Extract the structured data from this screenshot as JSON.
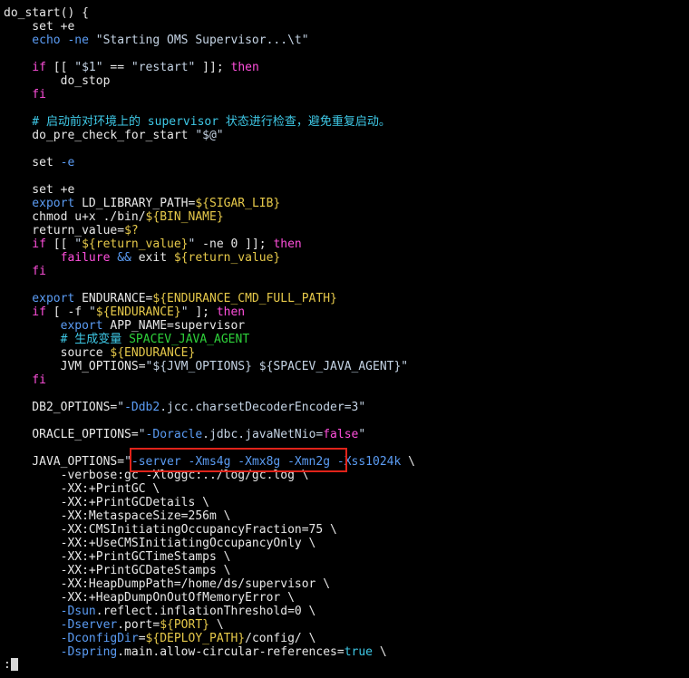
{
  "colors": {
    "default": "#e8e8e8",
    "keyword": "#ff4fdc",
    "string": "#c4d3e4",
    "variable": "#e6c94a",
    "option": "#5b9cf4",
    "comment": "#3ec8e6",
    "comment_text": "#2ed13a",
    "highlight_border": "#e0231a"
  },
  "lines": [
    [
      [
        "default",
        "do_start() {"
      ]
    ],
    [
      [
        "default",
        "    set +e"
      ]
    ],
    [
      [
        "option",
        "    echo -ne "
      ],
      [
        "string",
        "\"Starting OMS Supervisor...\\t\""
      ]
    ],
    [],
    [
      [
        "keyword",
        "    if"
      ],
      [
        "default",
        " [[ "
      ],
      [
        "string",
        "\"$1\""
      ],
      [
        "default",
        " == "
      ],
      [
        "string",
        "\"restart\""
      ],
      [
        "default",
        " ]]; "
      ],
      [
        "keyword",
        "then"
      ]
    ],
    [
      [
        "default",
        "        do_stop"
      ]
    ],
    [
      [
        "keyword",
        "    fi"
      ]
    ],
    [],
    [
      [
        "comment",
        "    # 启动前对环境上的 supervisor 状态进行检查，避免重复启动。"
      ]
    ],
    [
      [
        "default",
        "    do_pre_check_for_start "
      ],
      [
        "string",
        "\"$@\""
      ]
    ],
    [],
    [
      [
        "default",
        "    set "
      ],
      [
        "option",
        "-e"
      ]
    ],
    [],
    [
      [
        "default",
        "    set +e"
      ]
    ],
    [
      [
        "option",
        "    export"
      ],
      [
        "default",
        " LD_LIBRARY_PATH="
      ],
      [
        "variable",
        "${SIGAR_LIB}"
      ]
    ],
    [
      [
        "default",
        "    chmod u+x ./bin/"
      ],
      [
        "variable",
        "${BIN_NAME}"
      ]
    ],
    [
      [
        "default",
        "    return_value="
      ],
      [
        "variable",
        "$?"
      ]
    ],
    [
      [
        "keyword",
        "    if"
      ],
      [
        "default",
        " [[ "
      ],
      [
        "string",
        "\""
      ],
      [
        "variable",
        "${return_value}"
      ],
      [
        "string",
        "\""
      ],
      [
        "default",
        " -ne 0 ]]; "
      ],
      [
        "keyword",
        "then"
      ]
    ],
    [
      [
        "keyword",
        "        failure"
      ],
      [
        "default",
        " "
      ],
      [
        "option",
        "&&"
      ],
      [
        "default",
        " exit "
      ],
      [
        "variable",
        "${return_value}"
      ]
    ],
    [
      [
        "keyword",
        "    fi"
      ]
    ],
    [],
    [
      [
        "option",
        "    export"
      ],
      [
        "default",
        " ENDURANCE="
      ],
      [
        "variable",
        "${ENDURANCE_CMD_FULL_PATH}"
      ]
    ],
    [
      [
        "keyword",
        "    if"
      ],
      [
        "default",
        " [ -f "
      ],
      [
        "string",
        "\""
      ],
      [
        "variable",
        "${ENDURANCE}"
      ],
      [
        "string",
        "\""
      ],
      [
        "default",
        " ]; "
      ],
      [
        "keyword",
        "then"
      ]
    ],
    [
      [
        "option",
        "        export"
      ],
      [
        "default",
        " APP_NAME=supervisor"
      ]
    ],
    [
      [
        "comment",
        "        # 生成变量 "
      ],
      [
        "comment_text",
        "SPACEV_JAVA_AGENT"
      ]
    ],
    [
      [
        "default",
        "        source "
      ],
      [
        "variable",
        "${ENDURANCE}"
      ]
    ],
    [
      [
        "default",
        "        JVM_OPTIONS="
      ],
      [
        "string",
        "\"${JVM_OPTIONS} ${SPACEV_JAVA_AGENT}\""
      ]
    ],
    [
      [
        "keyword",
        "    fi"
      ]
    ],
    [],
    [
      [
        "default",
        "    DB2_OPTIONS="
      ],
      [
        "string",
        "\""
      ],
      [
        "option",
        "-Ddb2"
      ],
      [
        "string",
        ".jcc.charsetDecoderEncoder=3\""
      ]
    ],
    [],
    [
      [
        "default",
        "    ORACLE_OPTIONS="
      ],
      [
        "string",
        "\""
      ],
      [
        "option",
        "-Doracle"
      ],
      [
        "string",
        ".jdbc.javaNetNio="
      ],
      [
        "keyword",
        "false"
      ],
      [
        "string",
        "\""
      ]
    ],
    [],
    [
      [
        "default",
        "    JAVA_OPTIONS="
      ],
      [
        "string",
        "\""
      ],
      [
        "option",
        "-server -Xms4g -Xmx8g -Xmn2g -Xss1024k"
      ],
      [
        "default",
        " \\"
      ]
    ],
    [
      [
        "default",
        "        -verbose:gc -Xloggc:../log/gc.log \\"
      ]
    ],
    [
      [
        "default",
        "        -XX:+PrintGC \\"
      ]
    ],
    [
      [
        "default",
        "        -XX:+PrintGCDetails \\"
      ]
    ],
    [
      [
        "default",
        "        -XX:MetaspaceSize=256m \\"
      ]
    ],
    [
      [
        "default",
        "        -XX:CMSInitiatingOccupancyFraction=75 \\"
      ]
    ],
    [
      [
        "default",
        "        -XX:+UseCMSInitiatingOccupancyOnly \\"
      ]
    ],
    [
      [
        "default",
        "        -XX:+PrintGCTimeStamps \\"
      ]
    ],
    [
      [
        "default",
        "        -XX:+PrintGCDateStamps \\"
      ]
    ],
    [
      [
        "default",
        "        -XX:HeapDumpPath=/home/ds/supervisor \\"
      ]
    ],
    [
      [
        "default",
        "        -XX:+HeapDumpOnOutOfMemoryError \\"
      ]
    ],
    [
      [
        "option",
        "        -Dsun"
      ],
      [
        "default",
        ".reflect.inflationThreshold=0 \\"
      ]
    ],
    [
      [
        "option",
        "        -Dserver"
      ],
      [
        "default",
        ".port="
      ],
      [
        "variable",
        "${PORT}"
      ],
      [
        "default",
        " \\"
      ]
    ],
    [
      [
        "option",
        "        -DconfigDir"
      ],
      [
        "default",
        "="
      ],
      [
        "variable",
        "${DEPLOY_PATH}"
      ],
      [
        "default",
        "/config/ \\"
      ]
    ],
    [
      [
        "option",
        "        -Dspring"
      ],
      [
        "default",
        ".main.allow-circular-references="
      ],
      [
        "comment",
        "true"
      ],
      [
        "default",
        " \\"
      ]
    ]
  ],
  "prompt": ":"
}
